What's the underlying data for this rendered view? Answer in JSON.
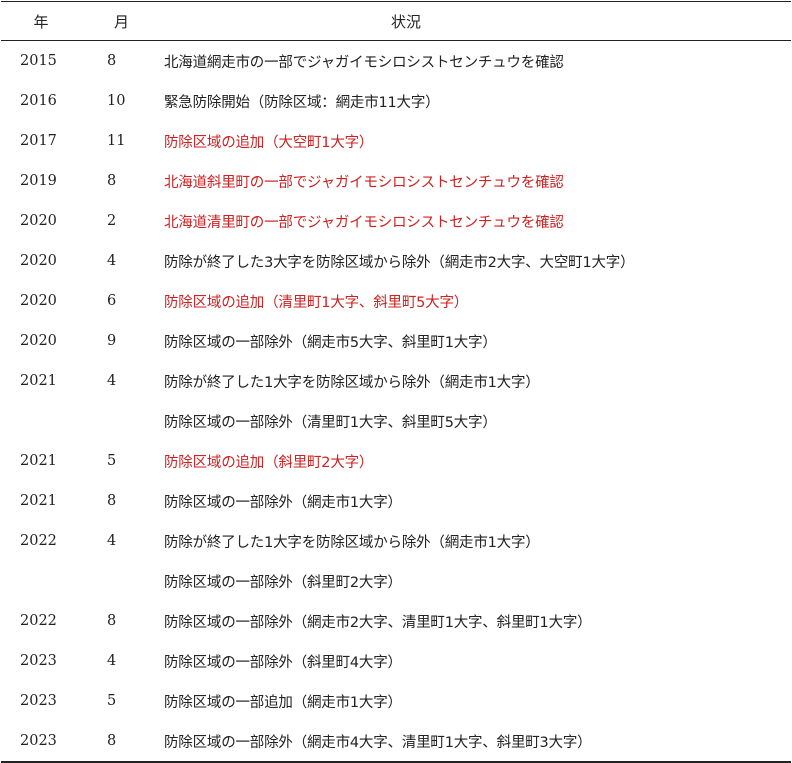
{
  "header": {
    "year": "年",
    "month": "月",
    "status": "状況"
  },
  "colors": {
    "text": "#222222",
    "highlight": "#cc2222"
  },
  "rows": [
    {
      "year": "2015",
      "month": "8",
      "status": "北海道網走市の一部でジャガイモシロシストセンチュウを確認",
      "red": false
    },
    {
      "year": "2016",
      "month": "10",
      "status": "緊急防除開始（防除区域：網走市11大字）",
      "red": false
    },
    {
      "year": "2017",
      "month": "11",
      "status": "防除区域の追加（大空町1大字）",
      "red": true
    },
    {
      "year": "2019",
      "month": "8",
      "status": "北海道斜里町の一部でジャガイモシロシストセンチュウを確認",
      "red": true
    },
    {
      "year": "2020",
      "month": "2",
      "status": "北海道清里町の一部でジャガイモシロシストセンチュウを確認",
      "red": true
    },
    {
      "year": "2020",
      "month": "4",
      "status": "防除が終了した3大字を防除区域から除外（網走市2大字、大空町1大字）",
      "red": false
    },
    {
      "year": "2020",
      "month": "6",
      "status": "防除区域の追加（清里町1大字、斜里町5大字）",
      "red": true
    },
    {
      "year": "2020",
      "month": "9",
      "status": "防除区域の一部除外（網走市5大字、斜里町1大字）",
      "red": false
    },
    {
      "year": "2021",
      "month": "4",
      "status": "防除が終了した1大字を防除区域から除外（網走市1大字）",
      "red": false
    },
    {
      "year": "",
      "month": "",
      "status": "防除区域の一部除外（清里町1大字、斜里町5大字）",
      "red": false
    },
    {
      "year": "2021",
      "month": "5",
      "status": "防除区域の追加（斜里町2大字）",
      "red": true
    },
    {
      "year": "2021",
      "month": "8",
      "status": "防除区域の一部除外（網走市1大字）",
      "red": false
    },
    {
      "year": "2022",
      "month": "4",
      "status": "防除が終了した1大字を防除区域から除外（網走市1大字）",
      "red": false
    },
    {
      "year": "",
      "month": "",
      "status": "防除区域の一部除外（斜里町2大字）",
      "red": false
    },
    {
      "year": "2022",
      "month": "8",
      "status": "防除区域の一部除外（網走市2大字、清里町1大字、斜里町1大字）",
      "red": false
    },
    {
      "year": "2023",
      "month": "4",
      "status": "防除区域の一部除外（斜里町4大字）",
      "red": false
    },
    {
      "year": "2023",
      "month": "5",
      "status": "防除区域の一部追加（網走市1大字）",
      "red": false
    },
    {
      "year": "2023",
      "month": "8",
      "status": "防除区域の一部除外（網走市4大字、清里町1大字、斜里町3大字）",
      "red": false
    }
  ]
}
